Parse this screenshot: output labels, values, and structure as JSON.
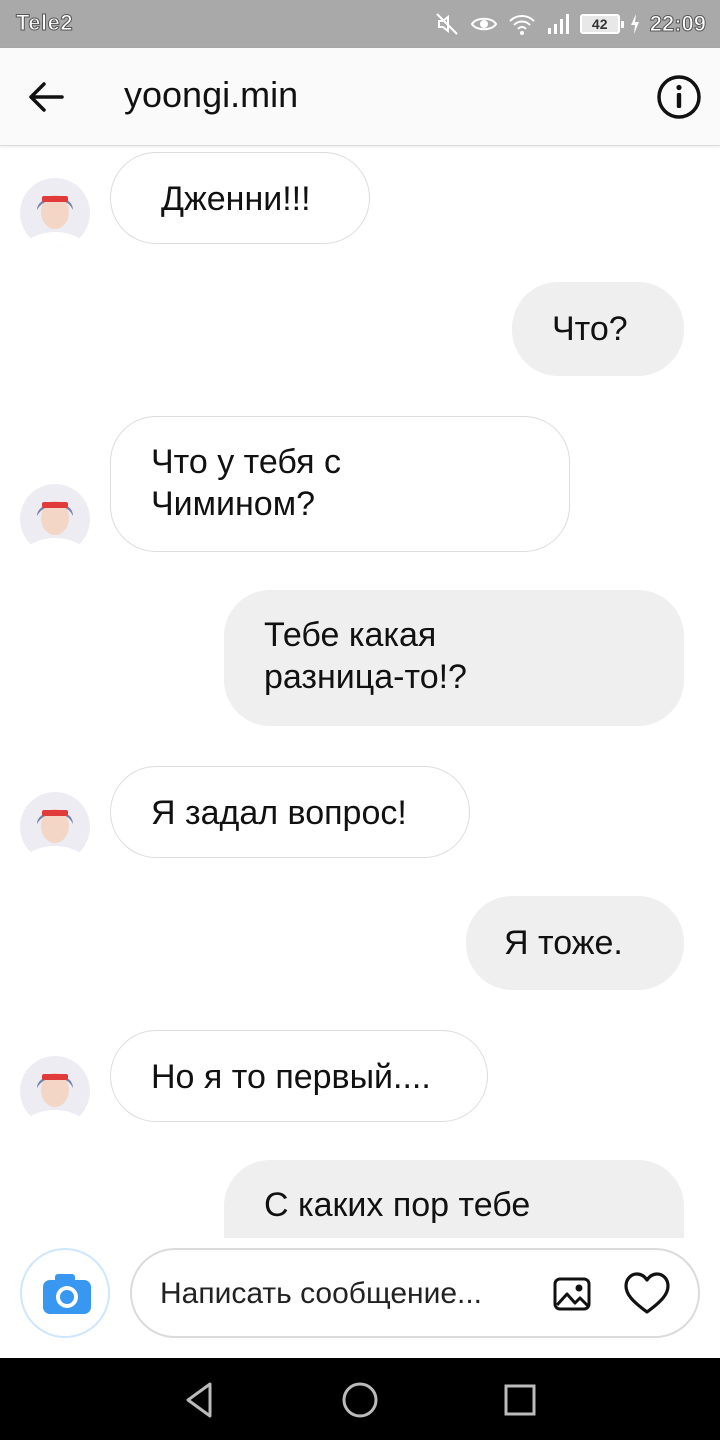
{
  "status_bar": {
    "carrier": "Tele2",
    "battery": "42",
    "time": "22:09",
    "icons": [
      "mute-icon",
      "eye-icon",
      "wifi-icon",
      "signal-icon",
      "battery-icon",
      "charging-icon"
    ]
  },
  "header": {
    "username": "yoongi.min",
    "back_icon": "arrow-left-icon",
    "info_icon": "info-icon"
  },
  "messages": [
    {
      "direction": "incoming",
      "lines": [
        "Дженни!!!"
      ]
    },
    {
      "direction": "outgoing",
      "lines": [
        "Что?"
      ]
    },
    {
      "direction": "incoming",
      "lines": [
        "Что у тебя с",
        "Чимином?"
      ]
    },
    {
      "direction": "outgoing",
      "lines": [
        "Тебе какая",
        "разница-то!?"
      ]
    },
    {
      "direction": "incoming",
      "lines": [
        "Я задал вопрос!"
      ]
    },
    {
      "direction": "outgoing",
      "lines": [
        "Я тоже."
      ]
    },
    {
      "direction": "incoming",
      "lines": [
        "Но я то первый...."
      ]
    },
    {
      "direction": "outgoing",
      "lines": [
        "С каких пор тебе"
      ]
    }
  ],
  "composer": {
    "placeholder": "Написать сообщение...",
    "camera_icon": "camera-icon",
    "gallery_icon": "image-icon",
    "like_icon": "heart-icon"
  },
  "nav_bar": {
    "icons": [
      "back-triangle-icon",
      "home-circle-icon",
      "recents-square-icon"
    ]
  },
  "colors": {
    "accent": "#3897f0",
    "outgoing_bubble": "#efefef",
    "incoming_border": "#dcdcdc"
  }
}
